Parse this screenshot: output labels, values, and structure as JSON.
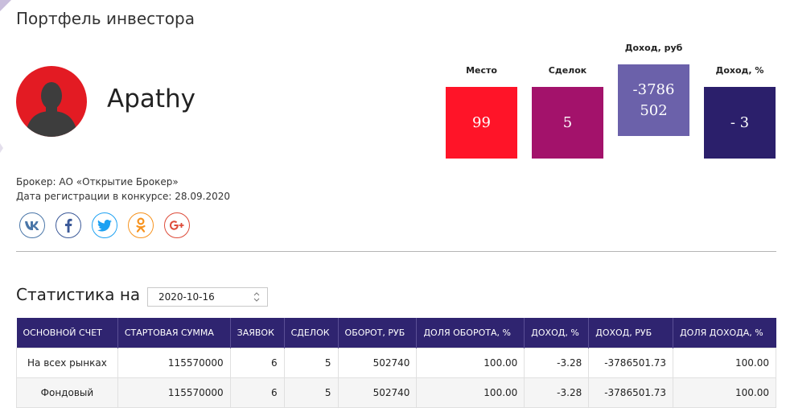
{
  "page": {
    "title": "Портфель инвестора"
  },
  "profile": {
    "username": "Apathy",
    "broker_label": "Брокер:",
    "broker_value": "АО «Открытие Брокер»",
    "registration_label": "Дата регистрации в конкурсе:",
    "registration_value": "28.09.2020"
  },
  "stats_boxes": [
    {
      "label": "Место",
      "value": "99",
      "color": "#ff1428"
    },
    {
      "label": "Сделок",
      "value": "5",
      "color": "#a3126b"
    },
    {
      "label": "Доход, руб",
      "value_line1": "-3786",
      "value_line2": "502",
      "color": "#6b61aa"
    },
    {
      "label": "Доход, %",
      "value": "- 3",
      "color": "#2b1f6b"
    }
  ],
  "social": [
    {
      "name": "vk",
      "glyph": "vk",
      "color": "#4a76a8"
    },
    {
      "name": "facebook",
      "glyph": "f",
      "color": "#3b5998"
    },
    {
      "name": "twitter",
      "glyph": "twitter",
      "color": "#1da1f2"
    },
    {
      "name": "odnoklassniki",
      "glyph": "ok",
      "color": "#f7931e"
    },
    {
      "name": "google-plus",
      "glyph": "G+",
      "color": "#dd4b39"
    }
  ],
  "statistics": {
    "heading": "Статистика на",
    "selected_date": "2020-10-16"
  },
  "table": {
    "headers": [
      "ОСНОВНОЙ СЧЕТ",
      "СТАРТОВАЯ СУММА",
      "ЗАЯВОК",
      "СДЕЛОК",
      "ОБОРОТ, РУБ",
      "ДОЛЯ ОБОРОТА, %",
      "ДОХОД, %",
      "ДОХОД, РУБ",
      "ДОЛЯ ДОХОДА, %"
    ],
    "rows": [
      [
        "На всех рынках",
        "115570000",
        "6",
        "5",
        "502740",
        "100.00",
        "-3.28",
        "-3786501.73",
        "100.00"
      ],
      [
        "Фондовый",
        "115570000",
        "6",
        "5",
        "502740",
        "100.00",
        "-3.28",
        "-3786501.73",
        "100.00"
      ]
    ]
  },
  "colors": {
    "table_header": "#2f2470",
    "avatar_bg": "#e31b23"
  }
}
